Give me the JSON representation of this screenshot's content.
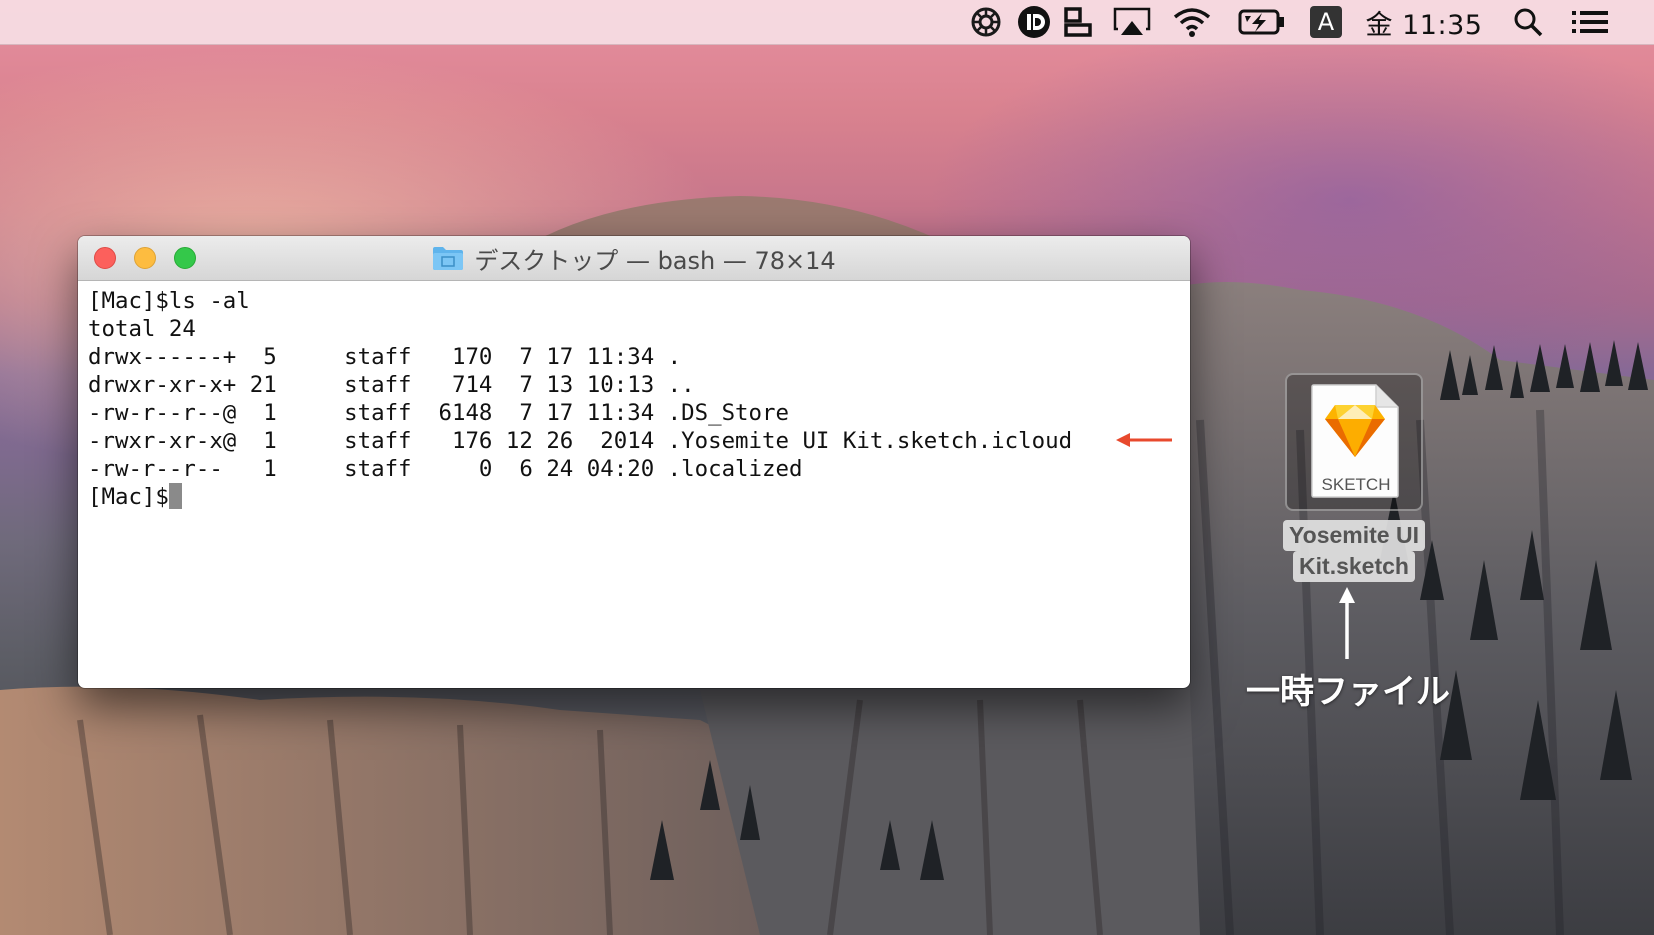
{
  "menubar": {
    "icons": [
      "gear-wheel-icon",
      "istat-icon",
      "window-tidy-icon",
      "airplay-icon",
      "wifi-icon",
      "battery-charging-icon",
      "input-method-icon",
      "spotlight-icon",
      "notification-center-icon"
    ],
    "input_method": "A",
    "clock": "金 11:35"
  },
  "terminal": {
    "title": "デスクトップ — bash — 78×14",
    "lines": [
      "[Mac]$ls -al",
      "total 24",
      "drwx------+  5     staff   170  7 17 11:34 .",
      "drwxr-xr-x+ 21     staff   714  7 13 10:13 ..",
      "-rw-r--r--@  1     staff  6148  7 17 11:34 .DS_Store",
      "-rwxr-xr-x@  1     staff   176 12 26  2014 .Yosemite UI Kit.sketch.icloud",
      "-rw-r--r--   1     staff     0  6 24 04:20 .localized",
      "[Mac]$"
    ],
    "highlight_color": "#e8492d"
  },
  "desktop_file": {
    "badge": "SKETCH",
    "name_line1": "Yosemite UI",
    "name_line2": "Kit.sketch"
  },
  "annotation": {
    "label": "一時ファイル",
    "arrow_color_left": "#e8492d",
    "arrow_color_up": "#ffffff"
  }
}
